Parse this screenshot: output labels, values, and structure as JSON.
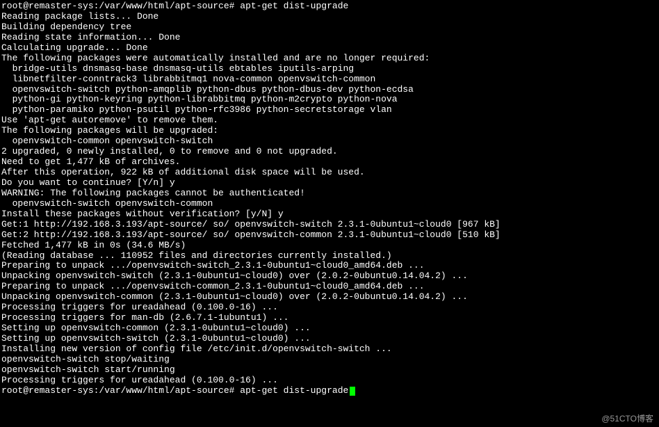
{
  "lines": [
    {
      "type": "prompt",
      "prefix": "root@remaster-sys:/var/www/html/apt-source#",
      "command": "apt-get dist-upgrade"
    },
    {
      "type": "text",
      "text": "Reading package lists... Done"
    },
    {
      "type": "text",
      "text": "Building dependency tree"
    },
    {
      "type": "text",
      "text": "Reading state information... Done"
    },
    {
      "type": "text",
      "text": "Calculating upgrade... Done"
    },
    {
      "type": "text",
      "text": "The following packages were automatically installed and are no longer required:"
    },
    {
      "type": "text",
      "text": "  bridge-utils dnsmasq-base dnsmasq-utils ebtables iputils-arping"
    },
    {
      "type": "text",
      "text": "  libnetfilter-conntrack3 librabbitmq1 nova-common openvswitch-common"
    },
    {
      "type": "text",
      "text": "  openvswitch-switch python-amqplib python-dbus python-dbus-dev python-ecdsa"
    },
    {
      "type": "text",
      "text": "  python-gi python-keyring python-librabbitmq python-m2crypto python-nova"
    },
    {
      "type": "text",
      "text": "  python-paramiko python-psutil python-rfc3986 python-secretstorage vlan"
    },
    {
      "type": "text",
      "text": "Use 'apt-get autoremove' to remove them."
    },
    {
      "type": "text",
      "text": "The following packages will be upgraded:"
    },
    {
      "type": "text",
      "text": "  openvswitch-common openvswitch-switch"
    },
    {
      "type": "text",
      "text": "2 upgraded, 0 newly installed, 0 to remove and 0 not upgraded."
    },
    {
      "type": "text",
      "text": "Need to get 1,477 kB of archives."
    },
    {
      "type": "text",
      "text": "After this operation, 922 kB of additional disk space will be used."
    },
    {
      "type": "text",
      "text": "Do you want to continue? [Y/n] y"
    },
    {
      "type": "text",
      "text": "WARNING: The following packages cannot be authenticated!"
    },
    {
      "type": "text",
      "text": "  openvswitch-switch openvswitch-common"
    },
    {
      "type": "text",
      "text": "Install these packages without verification? [y/N] y"
    },
    {
      "type": "text",
      "text": "Get:1 http://192.168.3.193/apt-source/ so/ openvswitch-switch 2.3.1-0ubuntu1~cloud0 [967 kB]"
    },
    {
      "type": "text",
      "text": "Get:2 http://192.168.3.193/apt-source/ so/ openvswitch-common 2.3.1-0ubuntu1~cloud0 [510 kB]"
    },
    {
      "type": "text",
      "text": "Fetched 1,477 kB in 0s (34.6 MB/s)"
    },
    {
      "type": "text",
      "text": "(Reading database ... 110952 files and directories currently installed.)"
    },
    {
      "type": "text",
      "text": "Preparing to unpack .../openvswitch-switch_2.3.1-0ubuntu1~cloud0_amd64.deb ..."
    },
    {
      "type": "text",
      "text": "Unpacking openvswitch-switch (2.3.1-0ubuntu1~cloud0) over (2.0.2-0ubuntu0.14.04.2) ..."
    },
    {
      "type": "text",
      "text": "Preparing to unpack .../openvswitch-common_2.3.1-0ubuntu1~cloud0_amd64.deb ..."
    },
    {
      "type": "text",
      "text": "Unpacking openvswitch-common (2.3.1-0ubuntu1~cloud0) over (2.0.2-0ubuntu0.14.04.2) ..."
    },
    {
      "type": "text",
      "text": "Processing triggers for ureadahead (0.100.0-16) ..."
    },
    {
      "type": "text",
      "text": "Processing triggers for man-db (2.6.7.1-1ubuntu1) ..."
    },
    {
      "type": "text",
      "text": "Setting up openvswitch-common (2.3.1-0ubuntu1~cloud0) ..."
    },
    {
      "type": "text",
      "text": "Setting up openvswitch-switch (2.3.1-0ubuntu1~cloud0) ..."
    },
    {
      "type": "text",
      "text": "Installing new version of config file /etc/init.d/openvswitch-switch ..."
    },
    {
      "type": "text",
      "text": "openvswitch-switch stop/waiting"
    },
    {
      "type": "text",
      "text": "openvswitch-switch start/running"
    },
    {
      "type": "text",
      "text": "Processing triggers for ureadahead (0.100.0-16) ..."
    },
    {
      "type": "prompt_cursor",
      "prefix": "root@remaster-sys:/var/www/html/apt-source#",
      "command": "apt-get dist-upgrade"
    }
  ],
  "watermark": "@51CTO博客"
}
